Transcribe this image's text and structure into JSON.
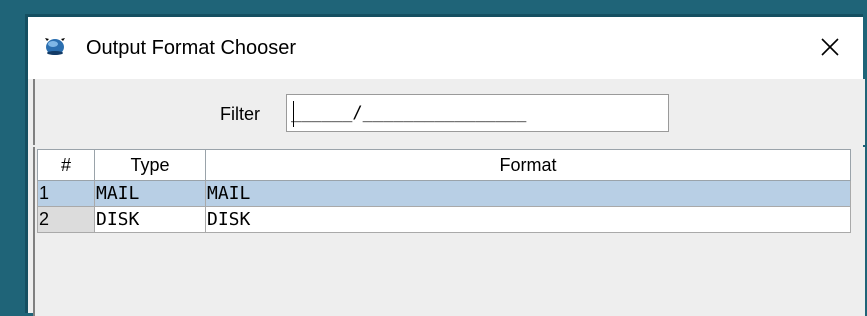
{
  "window": {
    "title": "Output Format Chooser",
    "icon": "globe-icon",
    "close_icon": "close-icon",
    "close_glyph": "✕"
  },
  "filter": {
    "label": "Filter",
    "value": "______/________________"
  },
  "table": {
    "columns": [
      "#",
      "Type",
      "Format"
    ],
    "rows": [
      {
        "num": "1",
        "type": "MAIL",
        "format": "MAIL",
        "selected": true
      },
      {
        "num": "2",
        "type": "DISK",
        "format": "DISK",
        "selected": false
      }
    ]
  },
  "colors": {
    "desktop": "#1f6478",
    "window_border": "#154f61",
    "selected_row": "#b8cfe5",
    "row_header": "#dcdcdc"
  }
}
